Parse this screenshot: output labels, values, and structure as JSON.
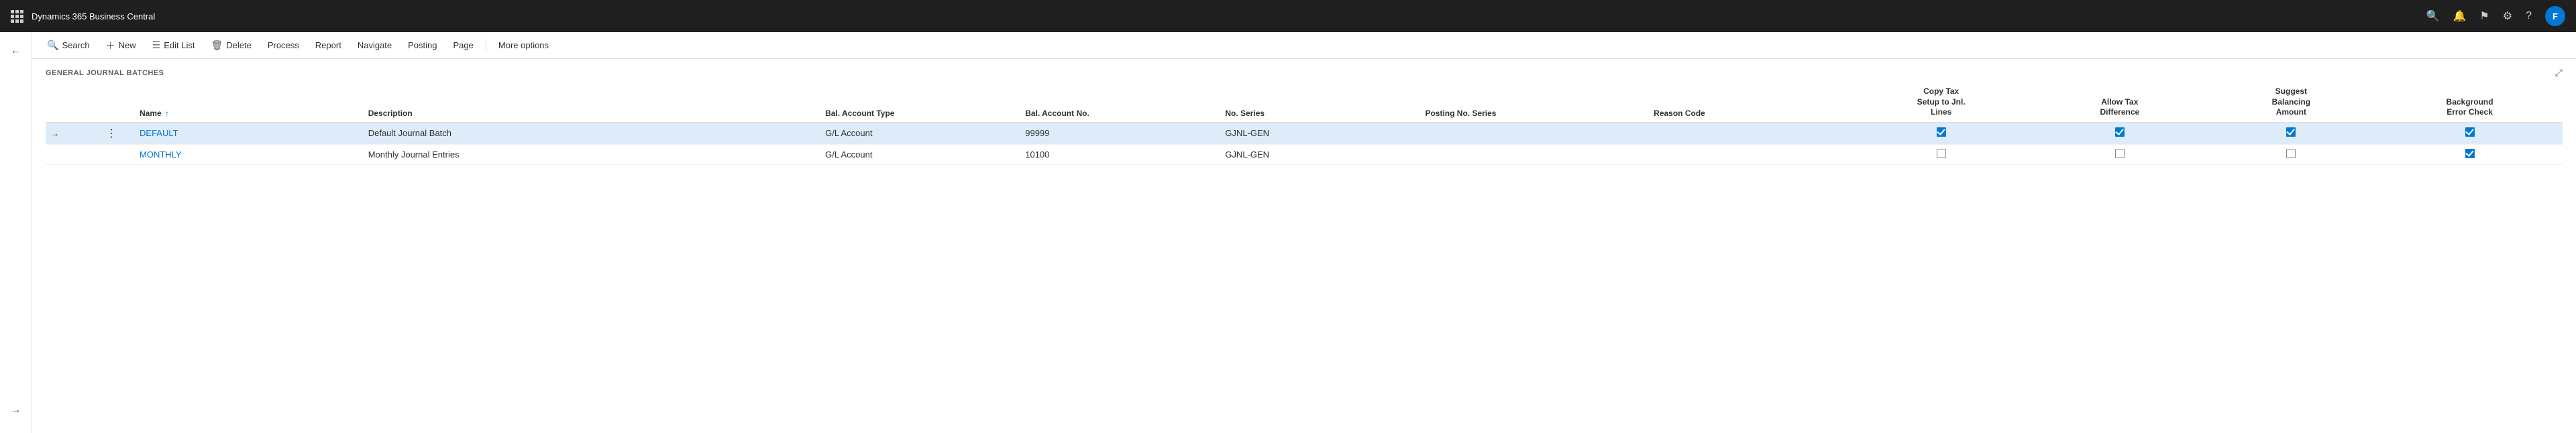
{
  "titlebar": {
    "app_name": "Dynamics 365 Business Central",
    "icons": {
      "search": "🔍",
      "bell": "🔔",
      "flag": "🚩",
      "settings": "⚙",
      "help": "?",
      "avatar_label": "F"
    }
  },
  "toolbar": {
    "search_label": "Search",
    "new_label": "New",
    "edit_list_label": "Edit List",
    "delete_label": "Delete",
    "process_label": "Process",
    "report_label": "Report",
    "navigate_label": "Navigate",
    "posting_label": "Posting",
    "page_label": "Page",
    "more_options_label": "More options"
  },
  "page": {
    "title": "GENERAL JOURNAL BATCHES"
  },
  "table": {
    "columns": [
      {
        "id": "col-arrow",
        "label": "",
        "lines": [
          ""
        ]
      },
      {
        "id": "col-menu",
        "label": "",
        "lines": [
          ""
        ]
      },
      {
        "id": "col-name",
        "label": "Name ↑",
        "lines": [
          "Name ↑"
        ]
      },
      {
        "id": "col-description",
        "label": "Description",
        "lines": [
          "Description"
        ]
      },
      {
        "id": "col-bal-type",
        "label": "Bal. Account Type",
        "lines": [
          "Bal. Account Type"
        ]
      },
      {
        "id": "col-bal-no",
        "label": "Bal. Account No.",
        "lines": [
          "Bal. Account No."
        ]
      },
      {
        "id": "col-series",
        "label": "No. Series",
        "lines": [
          "No. Series"
        ]
      },
      {
        "id": "col-posting-series",
        "label": "Posting No. Series",
        "lines": [
          "Posting No. Series"
        ]
      },
      {
        "id": "col-reason",
        "label": "Reason Code",
        "lines": [
          "Reason Code"
        ]
      },
      {
        "id": "col-copy-tax",
        "label": "Copy Tax Setup to Jnl. Lines",
        "lines": [
          "Copy Tax",
          "Setup to Jnl.",
          "Lines"
        ]
      },
      {
        "id": "col-allow-tax",
        "label": "Allow Tax Difference",
        "lines": [
          "Allow Tax",
          "Difference"
        ]
      },
      {
        "id": "col-suggest",
        "label": "Suggest Balancing Amount",
        "lines": [
          "Suggest",
          "Balancing",
          "Amount"
        ]
      },
      {
        "id": "col-bg-error",
        "label": "Background Error Check",
        "lines": [
          "Background",
          "Error Check"
        ]
      }
    ],
    "rows": [
      {
        "id": "row-default",
        "selected": true,
        "has_arrow": true,
        "has_menu": true,
        "name": "DEFAULT",
        "description": "Default Journal Batch",
        "bal_account_type": "G/L Account",
        "bal_account_no": "99999",
        "no_series": "GJNL-GEN",
        "posting_no_series": "",
        "reason_code": "",
        "copy_tax": true,
        "allow_tax": true,
        "suggest_balancing": true,
        "bg_error_check": true
      },
      {
        "id": "row-monthly",
        "selected": false,
        "has_arrow": false,
        "has_menu": false,
        "name": "MONTHLY",
        "description": "Monthly Journal Entries",
        "bal_account_type": "G/L Account",
        "bal_account_no": "10100",
        "no_series": "GJNL-GEN",
        "posting_no_series": "",
        "reason_code": "",
        "copy_tax": false,
        "allow_tax": false,
        "suggest_balancing": false,
        "bg_error_check": true
      }
    ]
  }
}
